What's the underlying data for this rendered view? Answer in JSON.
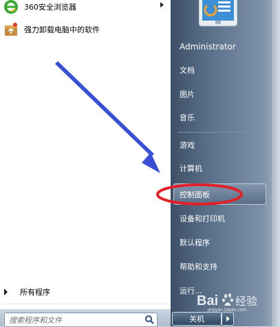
{
  "left_pane": {
    "programs": [
      {
        "label": "360安全浏览器",
        "icon": "360-browser-icon",
        "has_submenu": true
      },
      {
        "label": "强力卸载电脑中的软件",
        "icon": "uninstall-box-icon",
        "has_submenu": false
      }
    ],
    "all_programs": "所有程序",
    "search_placeholder": "搜索程序和文件"
  },
  "right_pane": {
    "user_name": "Administrator",
    "items": [
      "文档",
      "图片",
      "音乐",
      "游戏",
      "计算机",
      "控制面板",
      "设备和打印机",
      "默认程序",
      "帮助和支持",
      "运行..."
    ],
    "highlighted_item": "控制面板",
    "shutdown": "关机"
  },
  "annotations": {
    "arrow_color": "#3a4fd8",
    "ellipse_color": "#e2202a"
  },
  "watermark": {
    "brand": "Bai",
    "brand2": "百度",
    "sub": "jingyan.baidu.com"
  }
}
